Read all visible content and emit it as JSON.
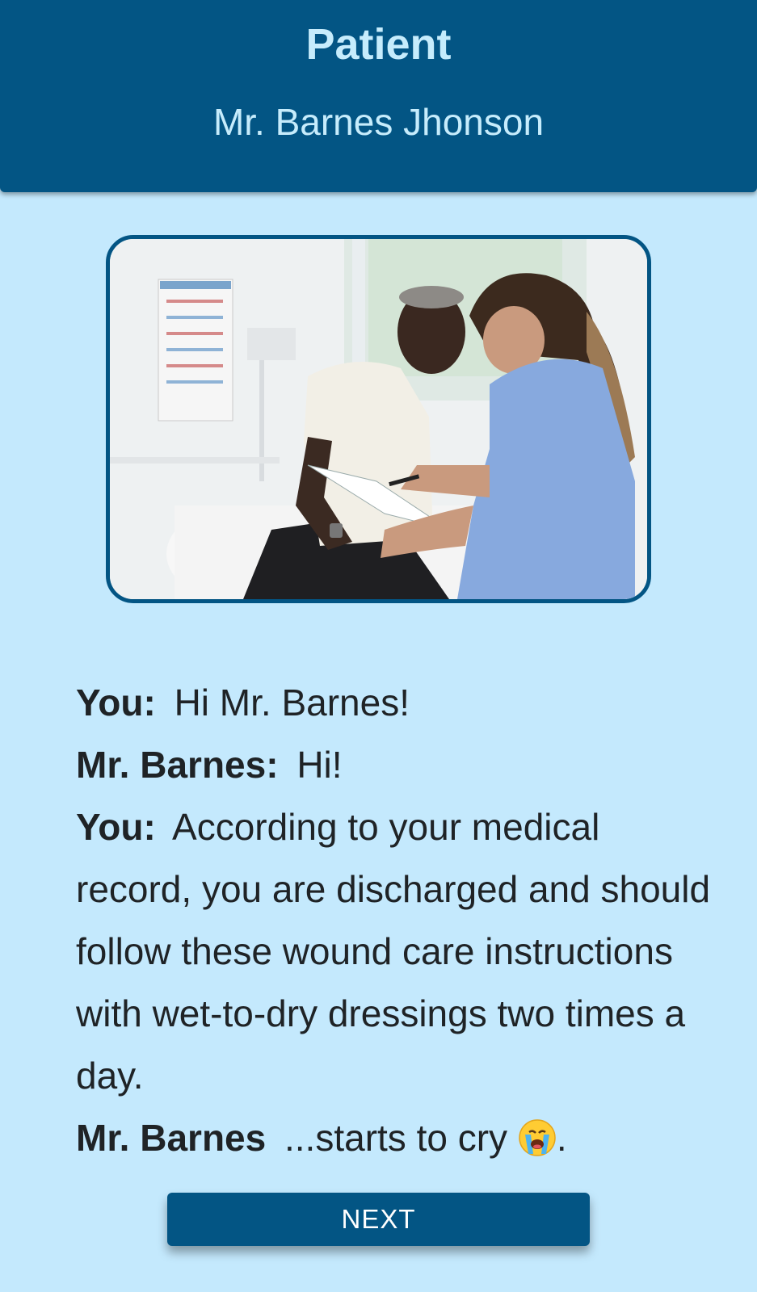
{
  "header": {
    "title": "Patient",
    "patient_name": "Mr. Barnes Jhonson"
  },
  "photo": {
    "description_icon": "patient-nurse-photo"
  },
  "dialogue": [
    {
      "speaker": "You:",
      "text": "Hi Mr. Barnes!"
    },
    {
      "speaker": "Mr. Barnes:",
      "text": "Hi!"
    },
    {
      "speaker": "You:",
      "text": "According to your medical record, you are discharged and should follow these wound care instructions with wet-to-dry dressings two times a day."
    },
    {
      "speaker": "Mr. Barnes",
      "text": " ...starts to cry",
      "emoji": "crying-face-icon",
      "suffix": "."
    }
  ],
  "actions": {
    "next_label": "NEXT"
  },
  "colors": {
    "primary": "#035584",
    "background": "#c4e9fd",
    "header_text": "#c6ecfc"
  }
}
